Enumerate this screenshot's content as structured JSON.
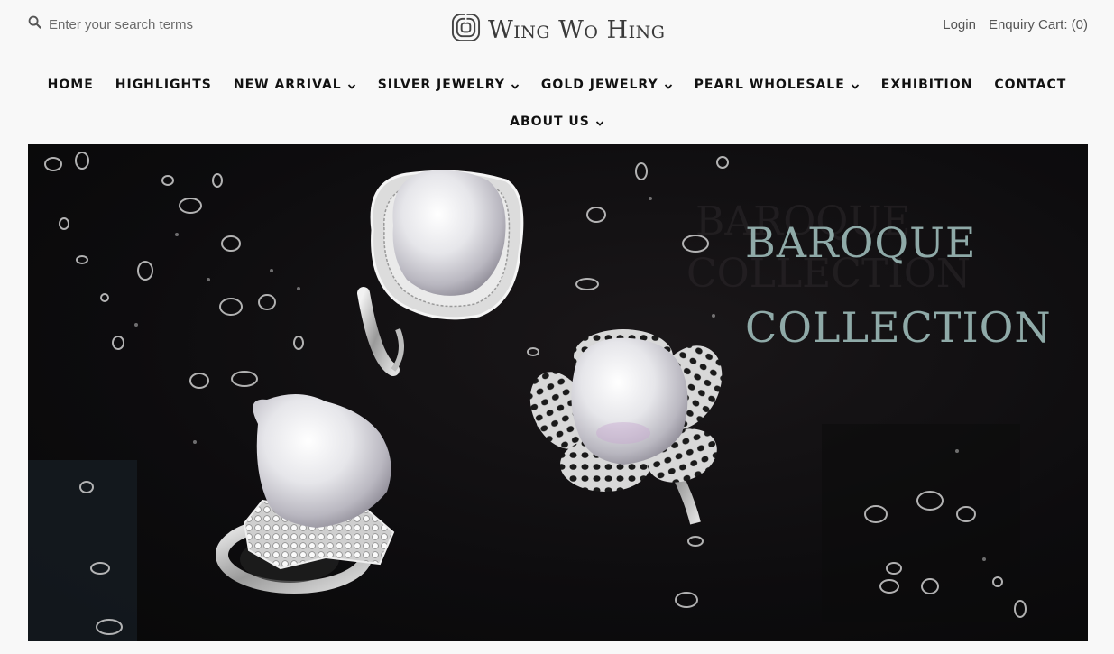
{
  "search": {
    "placeholder": "Enter your search terms",
    "icon": "search-icon"
  },
  "brand": {
    "name": "Wing Wo Hing",
    "logo_icon": "brand-swirl-logo-icon"
  },
  "account": {
    "login_label": "Login",
    "cart_label": "Enquiry Cart: (0)"
  },
  "nav": {
    "items": [
      {
        "label": "HOME",
        "dropdown": false
      },
      {
        "label": "HIGHLIGHTS",
        "dropdown": false
      },
      {
        "label": "NEW ARRIVAL",
        "dropdown": true
      },
      {
        "label": "SILVER JEWELRY",
        "dropdown": true
      },
      {
        "label": "GOLD JEWELRY",
        "dropdown": true
      },
      {
        "label": "PEARL WHOLESALE",
        "dropdown": true
      },
      {
        "label": "EXHIBITION",
        "dropdown": false
      },
      {
        "label": "CONTACT",
        "dropdown": false
      }
    ],
    "second_row": [
      {
        "label": "ABOUT US",
        "dropdown": true
      }
    ]
  },
  "hero": {
    "title_line1": "BAROQUE",
    "title_line2": "COLLECTION",
    "title_color": "#8faaa8",
    "background_color": "#0d0c0e"
  }
}
